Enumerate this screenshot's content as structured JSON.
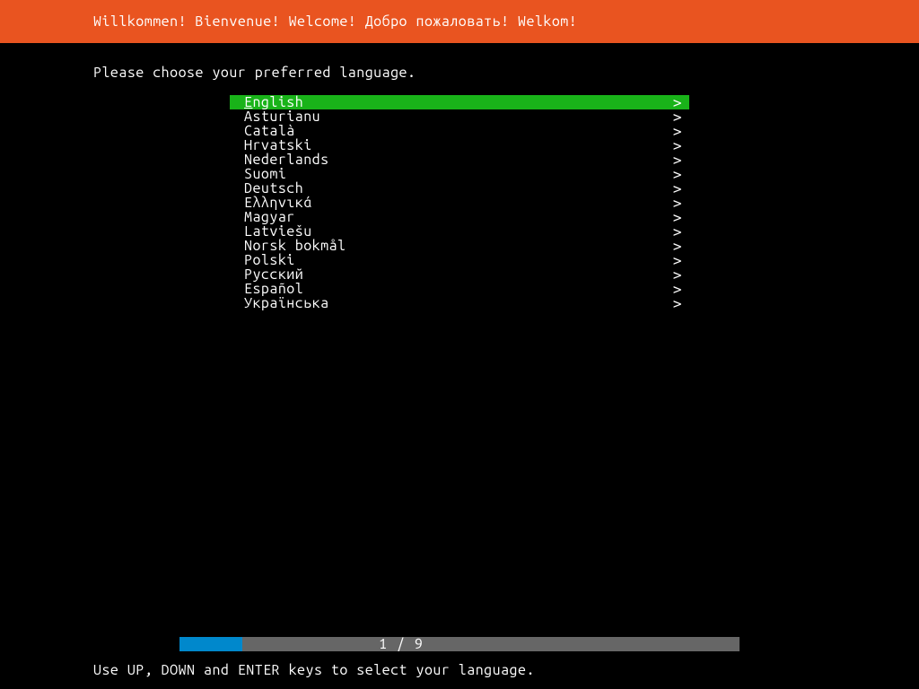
{
  "header": {
    "title": "Willkommen! Bienvenue! Welcome! Добро пожаловать! Welkom!"
  },
  "prompt": "Please choose your preferred language.",
  "languages": [
    {
      "label": "English",
      "selected": true
    },
    {
      "label": "Asturianu",
      "selected": false
    },
    {
      "label": "Català",
      "selected": false
    },
    {
      "label": "Hrvatski",
      "selected": false
    },
    {
      "label": "Nederlands",
      "selected": false
    },
    {
      "label": "Suomi",
      "selected": false
    },
    {
      "label": "Deutsch",
      "selected": false
    },
    {
      "label": "Ελληνικά",
      "selected": false
    },
    {
      "label": "Magyar",
      "selected": false
    },
    {
      "label": "Latviešu",
      "selected": false
    },
    {
      "label": "Norsk bokmål",
      "selected": false
    },
    {
      "label": "Polski",
      "selected": false
    },
    {
      "label": "Русский",
      "selected": false
    },
    {
      "label": "Español",
      "selected": false
    },
    {
      "label": "Українська",
      "selected": false
    }
  ],
  "chevron": ">",
  "progress": {
    "text": "1 / 9"
  },
  "hint": "Use UP, DOWN and ENTER keys to select your language."
}
